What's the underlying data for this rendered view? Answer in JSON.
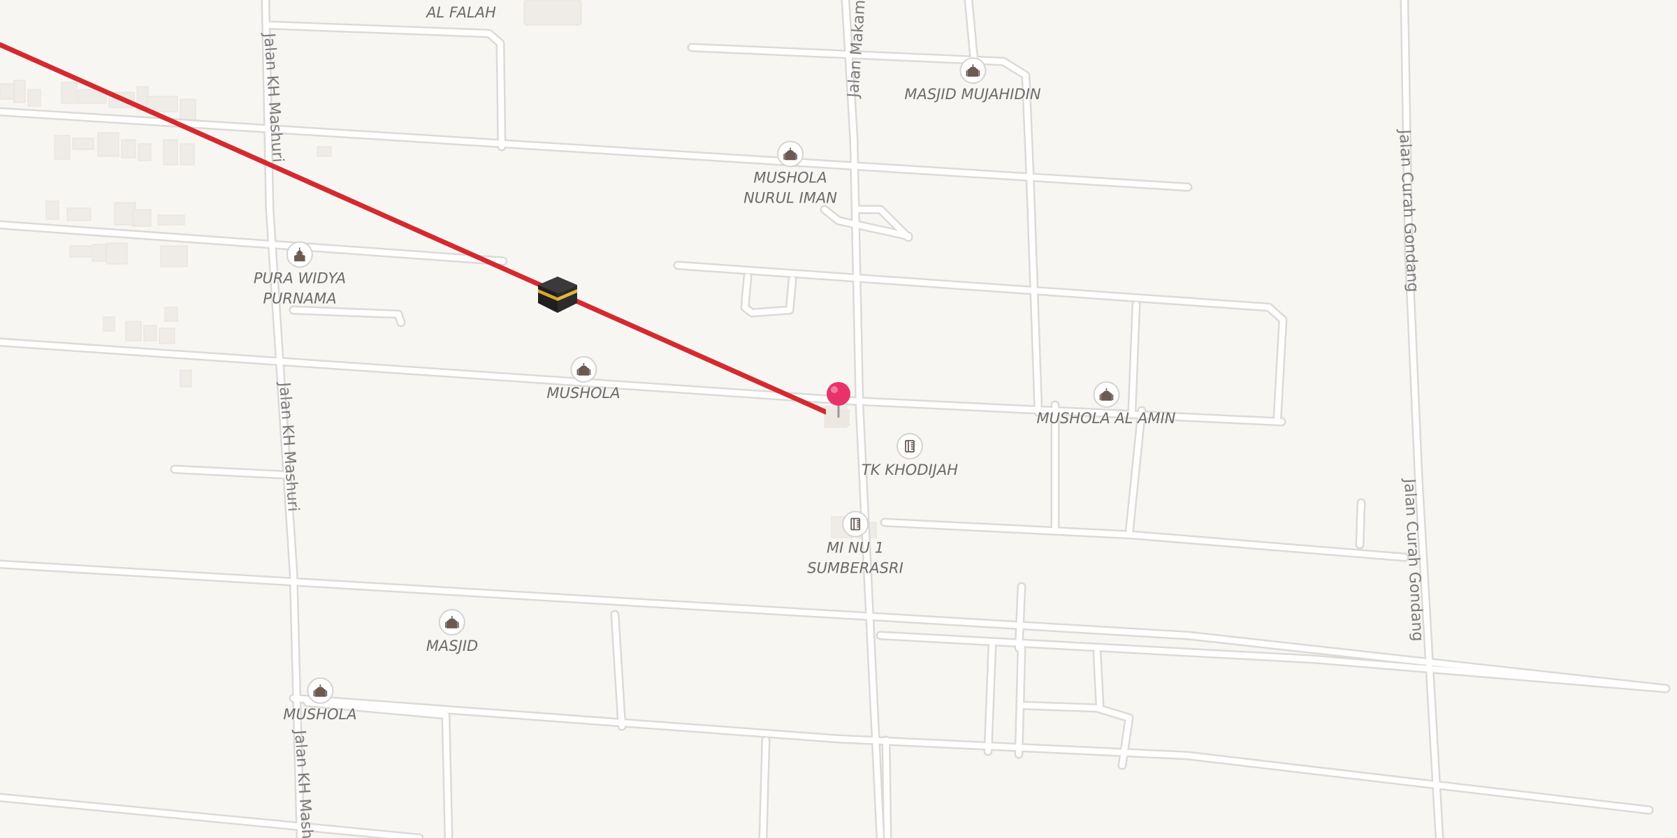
{
  "map": {
    "route_color": "#d42a2f",
    "pin_color": "#e8336a",
    "streets": {
      "kh_mashuri": "Jalan KH Mashuri",
      "makam": "Jalan Makam",
      "curah_gondang": "Jalan Curah Gondang"
    },
    "labels": {
      "al_falah": "AL FALAH"
    },
    "pois": [
      {
        "name": "MASJID MUJAHIDIN",
        "icon": "mosque-icon"
      },
      {
        "name": "MUSHOLA\nNURUL IMAN",
        "icon": "mosque-icon"
      },
      {
        "name": "PURA WIDYA\nPURNAMA",
        "icon": "temple-icon"
      },
      {
        "name": "MUSHOLA",
        "icon": "mosque-icon"
      },
      {
        "name": "MUSHOLA AL AMIN",
        "icon": "mosque-icon"
      },
      {
        "name": "TK KHODIJAH",
        "icon": "school-icon"
      },
      {
        "name": "MI NU 1\nSUMBERASRI",
        "icon": "school-icon"
      },
      {
        "name": "MASJID",
        "icon": "mosque-icon"
      },
      {
        "name": "MUSHOLA",
        "icon": "mosque-icon"
      }
    ],
    "kaaba_marker": "kaaba-icon",
    "location_pin": "location-pin-icon"
  }
}
